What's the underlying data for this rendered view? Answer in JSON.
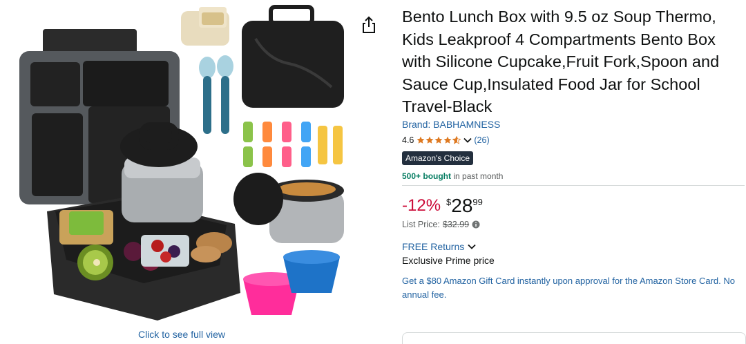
{
  "image": {
    "full_view_link": "Click to see full view"
  },
  "product": {
    "title": "Bento Lunch Box with 9.5 oz Soup Thermo, Kids Leakproof 4 Compartments Bento Box with Silicone Cupcake,Fruit Fork,Spoon and Sauce Cup,Insulated Food Jar for School Travel-Black",
    "brand": "Brand: BABHAMNESS",
    "rating": "4.6",
    "stars_value": 4.6,
    "review_count": "(26)",
    "badge": "Amazon's Choice",
    "bought_bold": "500+ bought",
    "bought_rest": " in past month"
  },
  "price": {
    "discount": "-12%",
    "currency": "$",
    "whole": "28",
    "fraction": "99",
    "list_label": "List Price:",
    "list_value": "$32.99"
  },
  "delivery": {
    "returns": "FREE Returns",
    "prime_price": "Exclusive Prime price",
    "gift_offer": "Get a $80 Amazon Gift Card instantly upon approval for the Amazon Store Card. No annual fee."
  },
  "colors": {
    "link": "#2162a1",
    "discount": "#cc0c39",
    "star": "#de7921",
    "badge_bg": "#232f3e",
    "bought": "#067d62"
  },
  "icons": [
    "share-icon",
    "star-icon",
    "chevron-down-icon",
    "info-icon"
  ]
}
